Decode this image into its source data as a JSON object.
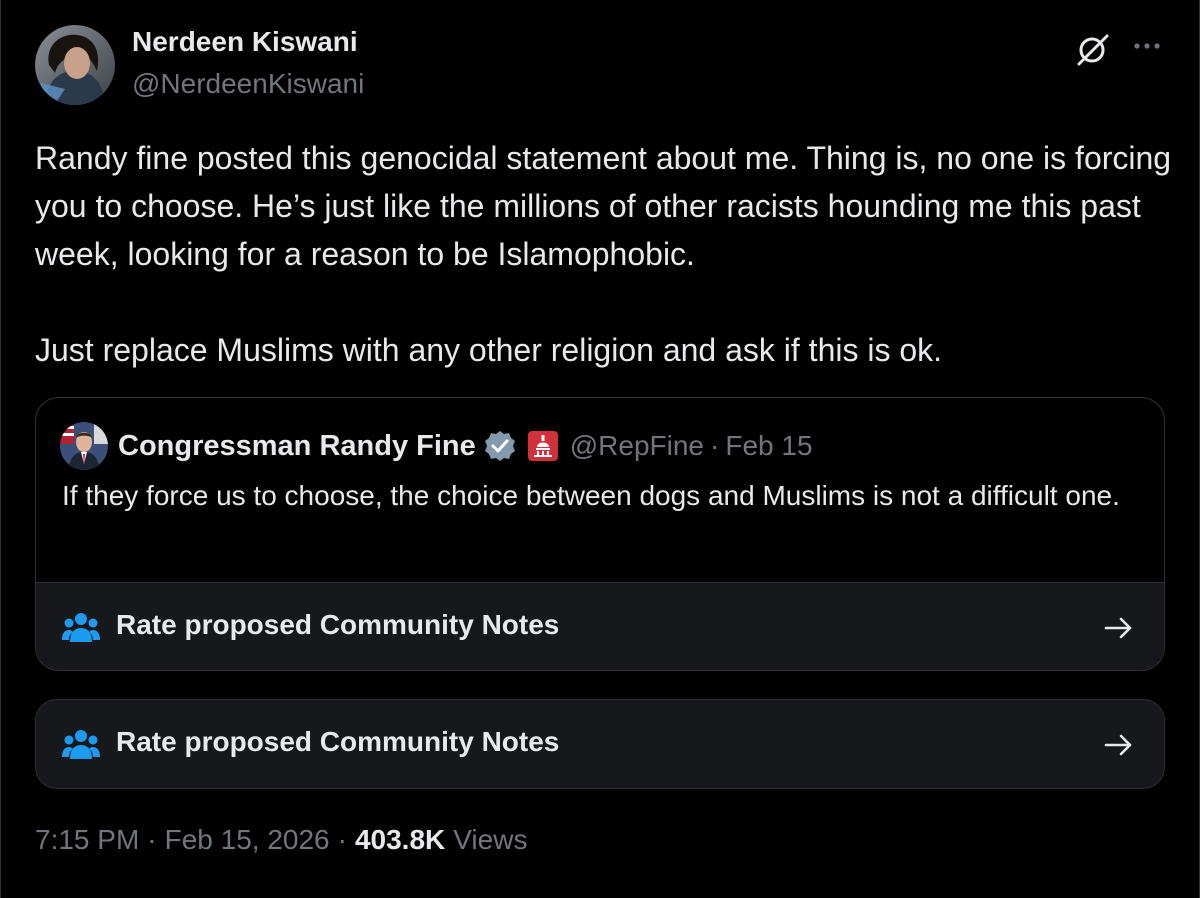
{
  "post": {
    "author_name": "Nerdeen Kiswani",
    "author_handle": "@NerdeenKiswani",
    "text_lines": [
      "Randy fine posted this genocidal statement about me. Thing is, no one is forcing you to choose. He’s just like the millions of other racists hounding me this past week, looking for a reason to be Islamophobic.",
      "Just replace Muslims with any other religion and ask if this is ok."
    ],
    "icons": {
      "grok": "grok-icon",
      "more": "more-icon"
    }
  },
  "quote": {
    "author_name": "Congressman Randy Fine",
    "handle": "@RepFine",
    "separator": "·",
    "date": "Feb 15",
    "text": "If they force us to choose, the choice between dogs and Muslims is not a difficult one.",
    "verified_color": "#829aab",
    "affiliation_color": "#d0323b",
    "community_notes_label": "Rate proposed Community Notes"
  },
  "community_notes": {
    "label": "Rate proposed Community Notes",
    "icon": "people-icon",
    "icon_color": "#1d9bf0"
  },
  "meta": {
    "time": "7:15 PM",
    "separator": "·",
    "date": "Feb 15, 2026",
    "views_count": "403.8K",
    "views_label": "Views"
  },
  "colors": {
    "background": "#000000",
    "text_primary": "#e7e9ea",
    "text_secondary": "#71767b",
    "border": "#2f3336",
    "accent": "#1d9bf0"
  }
}
